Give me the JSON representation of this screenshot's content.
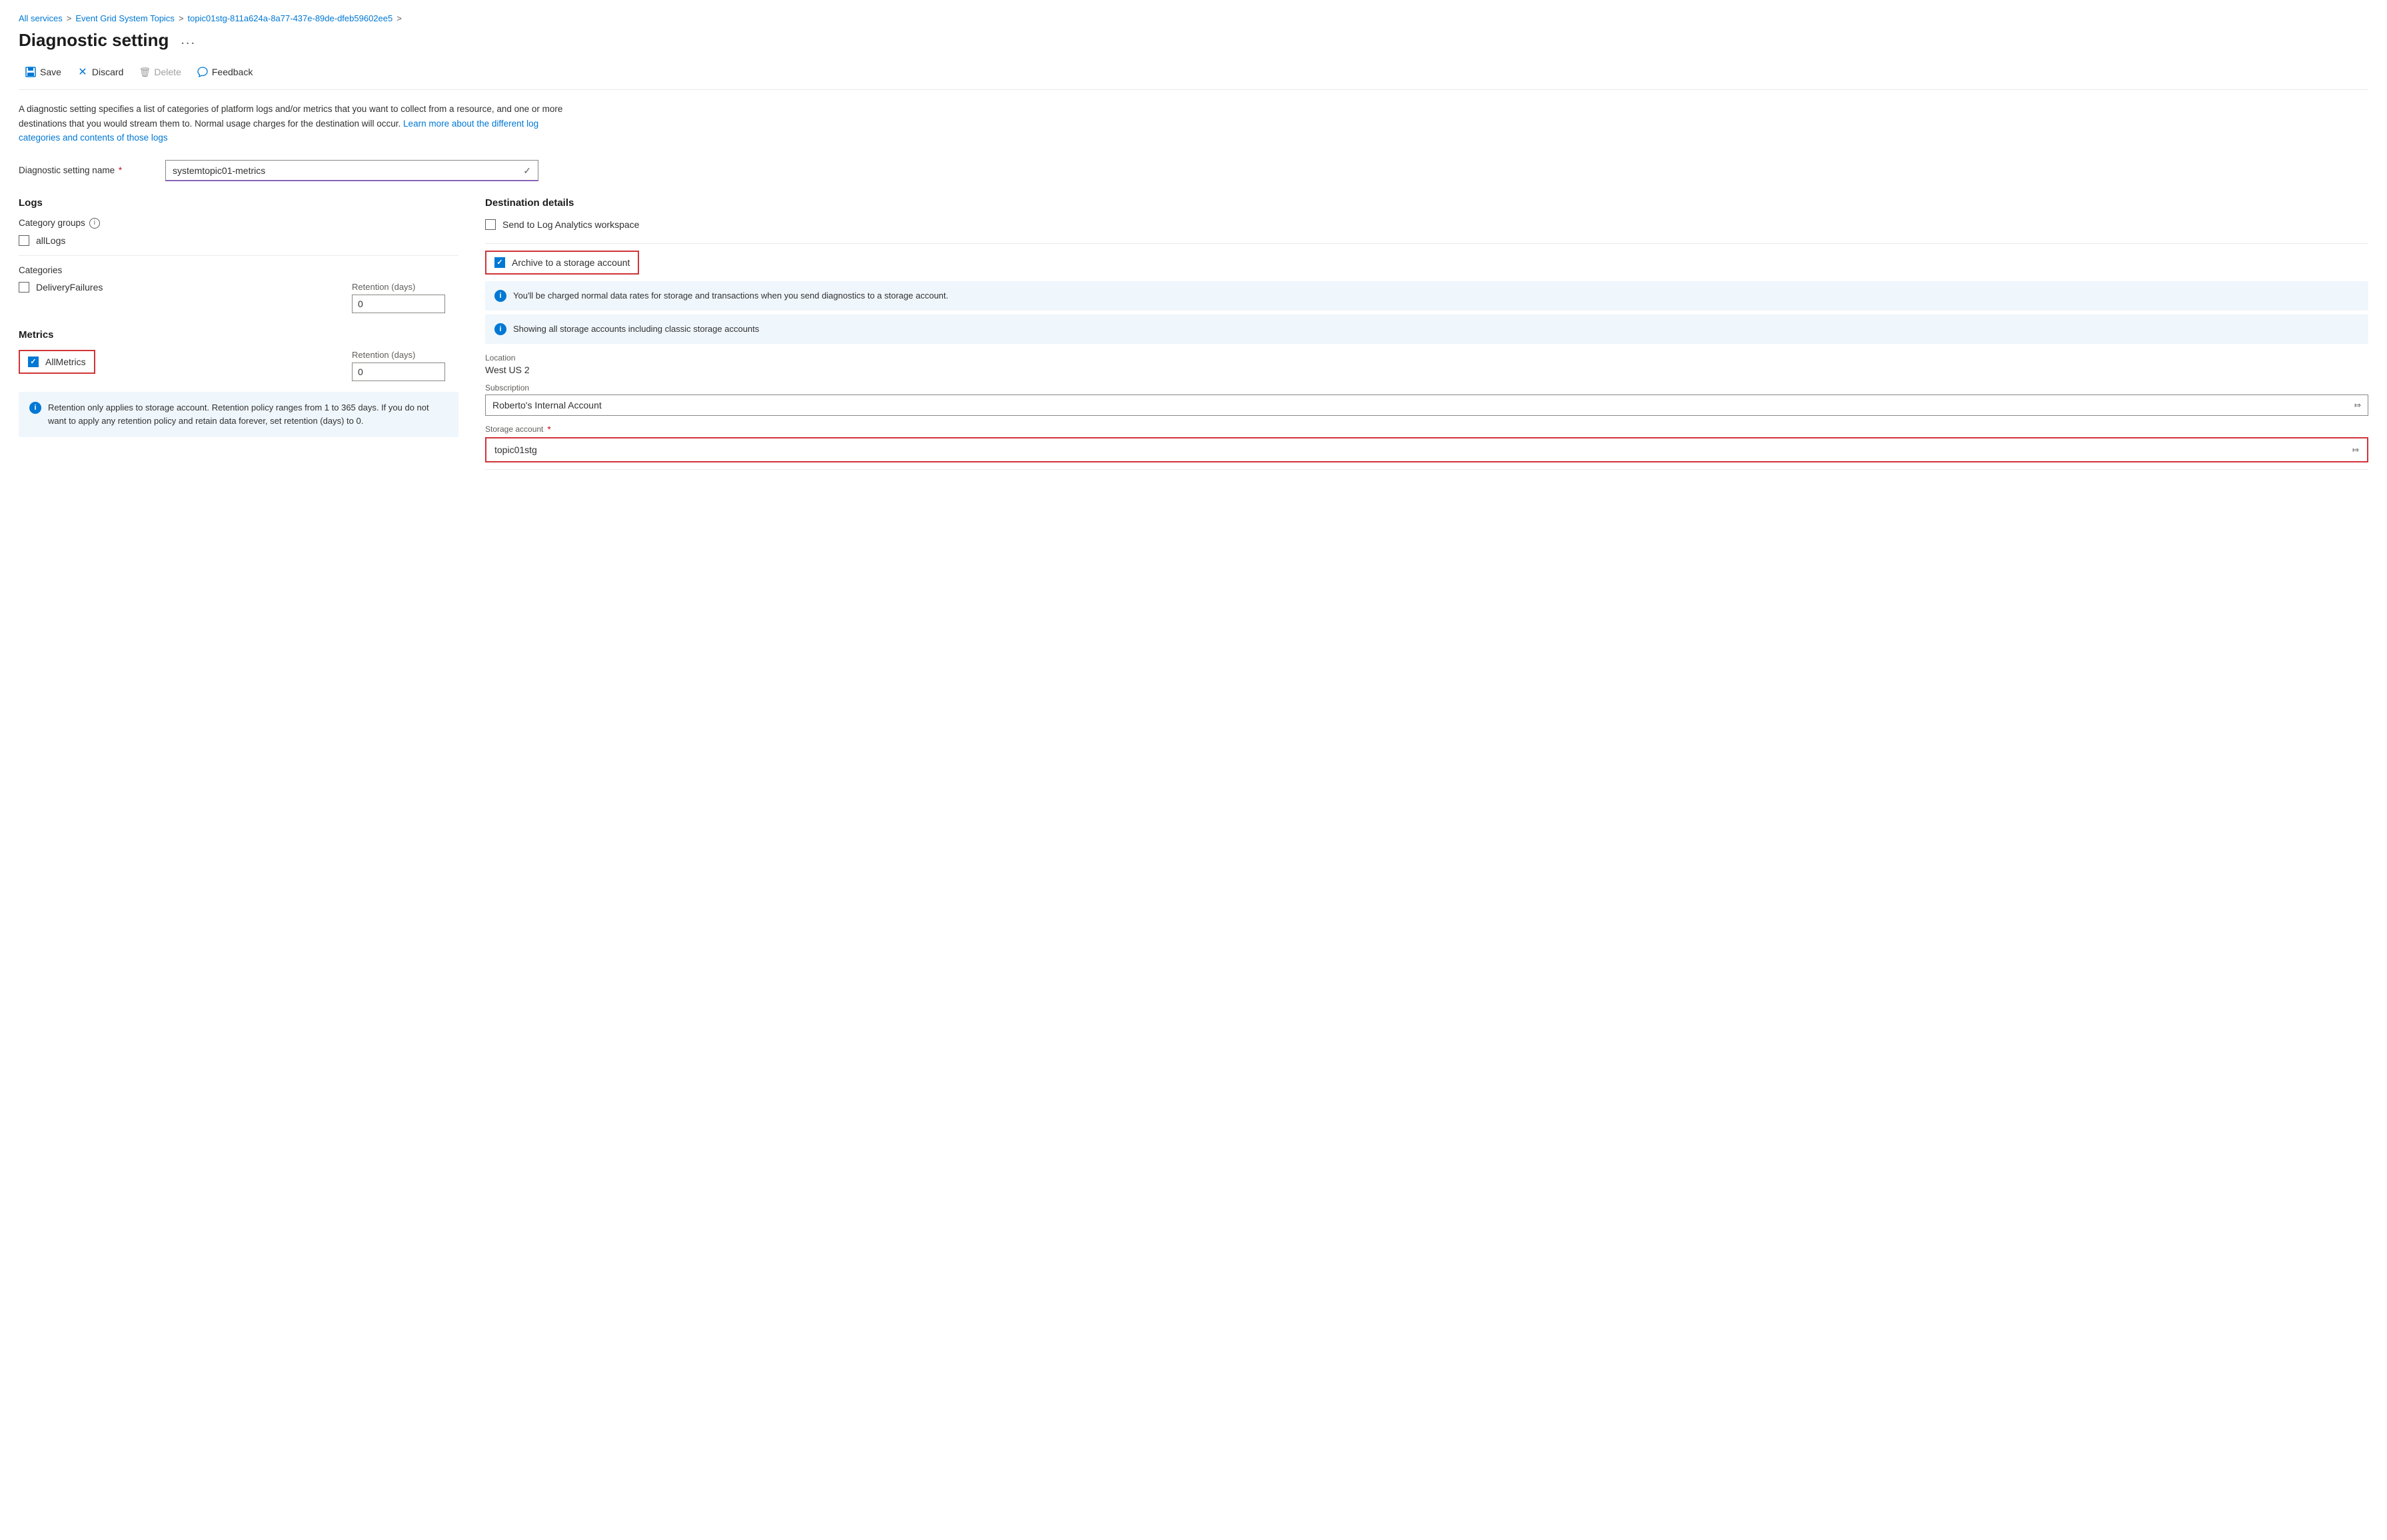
{
  "breadcrumb": {
    "items": [
      {
        "label": "All services",
        "link": true
      },
      {
        "label": "Event Grid System Topics",
        "link": true
      },
      {
        "label": "topic01stg-811a624a-8a77-437e-89de-dfeb59602ee5",
        "link": true
      }
    ]
  },
  "page": {
    "title": "Diagnostic setting",
    "ellipsis": "..."
  },
  "toolbar": {
    "save": "Save",
    "discard": "Discard",
    "delete": "Delete",
    "feedback": "Feedback"
  },
  "description": {
    "main": "A diagnostic setting specifies a list of categories of platform logs and/or metrics that you want to collect from a resource, and one or more destinations that you would stream them to. Normal usage charges for the destination will occur. ",
    "link_text": "Learn more about the different log categories and contents of those logs"
  },
  "diagnostic_setting_name": {
    "label": "Diagnostic setting name",
    "required": true,
    "value": "systemtopic01-metrics",
    "check_icon": "✓"
  },
  "logs": {
    "section_title": "Logs",
    "category_groups": {
      "label": "Category groups",
      "has_info": true,
      "options": [
        {
          "id": "allLogs",
          "label": "allLogs",
          "checked": false
        }
      ]
    },
    "categories": {
      "label": "Categories",
      "options": [
        {
          "id": "DeliveryFailures",
          "label": "DeliveryFailures",
          "checked": false,
          "retention_label": "Retention (days)",
          "retention_value": "0"
        }
      ]
    }
  },
  "metrics": {
    "section_title": "Metrics",
    "options": [
      {
        "id": "AllMetrics",
        "label": "AllMetrics",
        "checked": true,
        "highlighted": true,
        "retention_label": "Retention (days)",
        "retention_value": "0"
      }
    ],
    "info_box": {
      "text": "Retention only applies to storage account. Retention policy ranges from 1 to 365 days. If you do not want to apply any retention policy and retain data forever, set retention (days) to 0."
    }
  },
  "destination": {
    "section_title": "Destination details",
    "options": [
      {
        "id": "log_analytics",
        "label": "Send to Log Analytics workspace",
        "checked": false,
        "highlighted": false
      },
      {
        "id": "archive_storage",
        "label": "Archive to a storage account",
        "checked": true,
        "highlighted": true
      }
    ],
    "info_notes": [
      {
        "text": "You'll be charged normal data rates for storage and transactions when you send diagnostics to a storage account."
      },
      {
        "text": "Showing all storage accounts including classic storage accounts"
      }
    ],
    "location": {
      "label": "Location",
      "value": "West US 2"
    },
    "subscription": {
      "label": "Subscription",
      "value": "Roberto's Internal Account"
    },
    "storage_account": {
      "label": "Storage account",
      "required": true,
      "value": "topic01stg",
      "highlighted": true
    }
  }
}
